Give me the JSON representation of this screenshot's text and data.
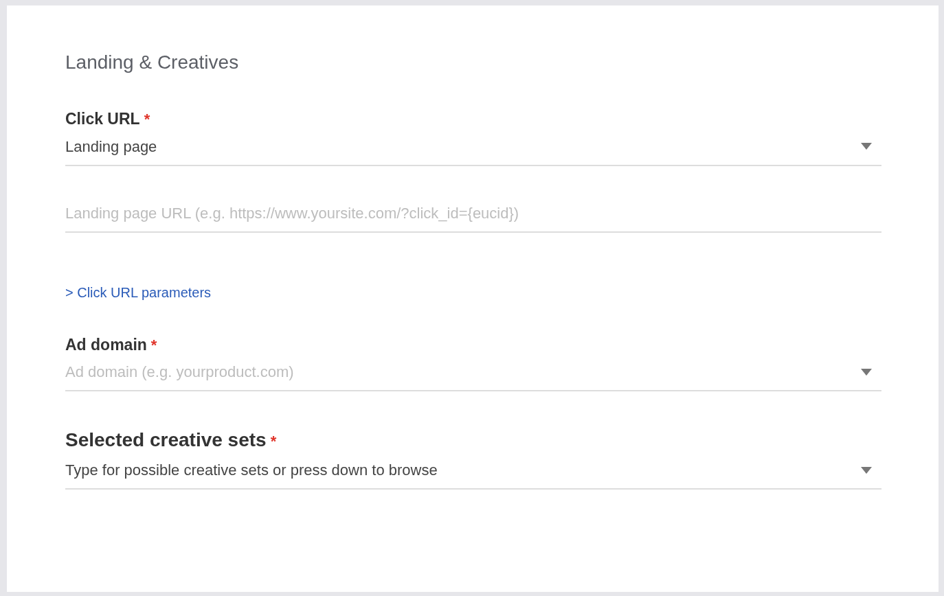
{
  "section_title": "Landing & Creatives",
  "fields": [
    {
      "kind": "select",
      "label": "Click URL",
      "required_mark": "*",
      "value": "Landing page"
    },
    {
      "kind": "input",
      "placeholder": "Landing page URL (e.g. https://www.yoursite.com/?click_id={eucid})"
    },
    {
      "kind": "link",
      "text": "> Click URL parameters"
    },
    {
      "kind": "select",
      "label": "Ad domain",
      "required_mark": "*",
      "placeholder": "Ad domain (e.g. yourproduct.com)"
    },
    {
      "kind": "large_select",
      "label": "Selected creative sets",
      "required_mark": "*",
      "value": "Type for possible creative sets or press down to browse"
    }
  ]
}
